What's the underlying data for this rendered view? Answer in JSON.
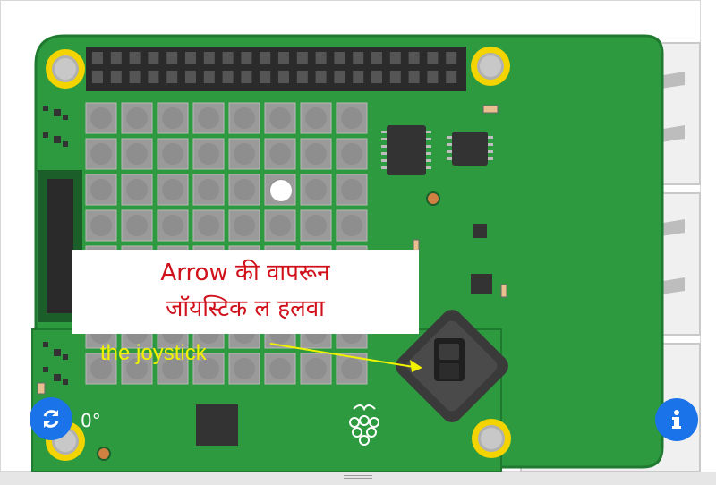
{
  "instruction": {
    "line1": "Arrow की  वापरून",
    "line2": "जॉयस्टिक  ल  हलवा"
  },
  "annotation": {
    "label": "the joystick"
  },
  "temperature_readout": "0°",
  "icons": {
    "rotate": "rotate-icon",
    "info": "info-icon",
    "raspberry": "raspberry-pi-logo-icon"
  },
  "colors": {
    "board_green": "#2e9a3f",
    "pixel_grey": "#9a9a9a",
    "lit_pixel": "#ffffff",
    "mount_ring": "#f3d400",
    "joystick": "#4a4a4a",
    "accent_blue": "#1a73e8",
    "annotation_yellow": "#f2f200",
    "instruction_red": "#d0101a"
  }
}
